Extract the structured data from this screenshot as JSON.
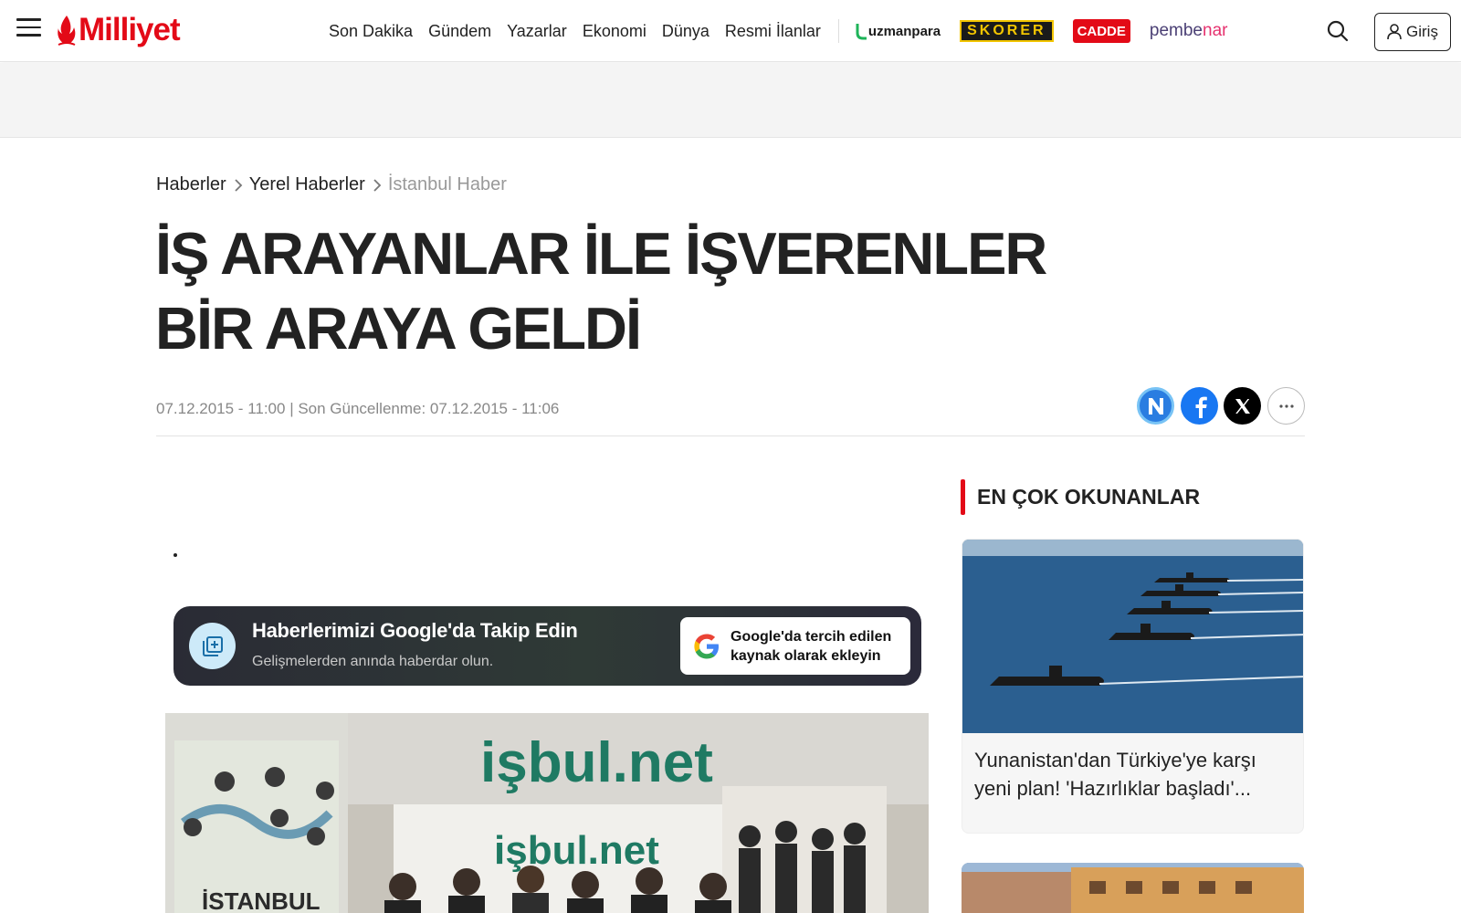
{
  "header": {
    "logo": "Milliyet",
    "nav": [
      "Son Dakika",
      "Gündem",
      "Yazarlar",
      "Ekonomi",
      "Dünya",
      "Resmi İlanlar"
    ],
    "brands": {
      "uzmanpara": "uzmanpara",
      "skorer": "SKORER",
      "cadde": "CADDE",
      "pembe": "pembe",
      "nar": "nar"
    },
    "login_label": "Giriş"
  },
  "breadcrumb": {
    "items": [
      "Haberler",
      "Yerel Haberler"
    ],
    "current": "İstanbul Haber"
  },
  "article": {
    "title": "İŞ ARAYANLAR İLE İŞVERENLER BİR ARAYA GELDİ",
    "meta": "07.12.2015 - 11:00 | Son Güncellenme: 07.12.2015 - 11:06"
  },
  "google_card": {
    "title": "Haberlerimizi Google'da Takip Edin",
    "subtitle": "Gelişmelerden anında haberdar olun.",
    "button_line1": "Google'da tercih edilen",
    "button_line2": "kaynak olarak ekleyin"
  },
  "article_image": {
    "sign_top": "işbul.net",
    "sign_lower": "işbul.net",
    "left_banner": "İSTANBUL"
  },
  "sidebar": {
    "heading": "EN ÇOK OKUNANLAR",
    "cards": [
      {
        "title": "Yunanistan'dan Türkiye'ye karşı yeni plan! 'Hazırlıklar başladı'..."
      }
    ]
  },
  "colors": {
    "brand_red": "#e30a17",
    "text": "#222222",
    "meta_gray": "#888888"
  }
}
